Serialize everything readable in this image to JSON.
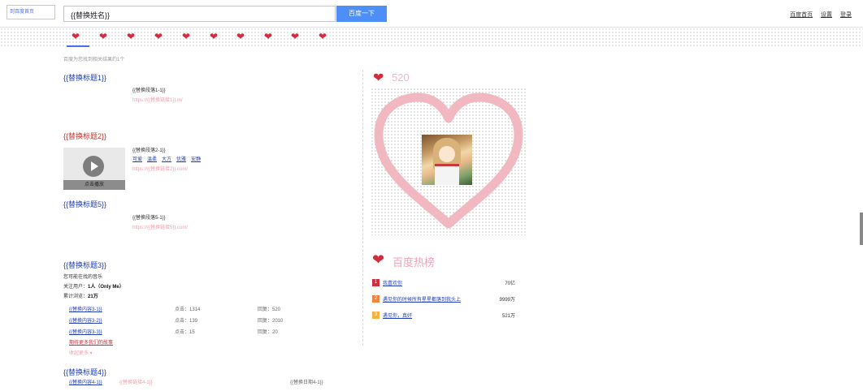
{
  "header": {
    "logo_alt": "到百度首页",
    "search_value": "{{替换姓名}}",
    "search_button": "百度一下",
    "links": [
      "百度首页",
      "设置",
      "登录"
    ]
  },
  "heart_strip": {
    "count": 10
  },
  "result_count": "百度为您找到相关结果约1个",
  "results": {
    "r1": {
      "title": "{{替换标题1}}",
      "desc": "{{替换段落1-1}}",
      "url": "https://{{替换链接1}}.m/"
    },
    "r2": {
      "title": "{{替换标题2}}",
      "desc": "{{替换段落2-1}}",
      "sublinks": [
        "可爱",
        "温柔",
        "大方",
        "优雅",
        "安静"
      ],
      "url": "https://{{替换链接2}}.com/",
      "video_label": "点击播放"
    },
    "r3": {
      "title": "{{替换标题5}}",
      "desc": "{{替换段落5-1}}",
      "url": "https://{{替换链接5}}.com/"
    },
    "r4": {
      "title": "{{替换标题3}}",
      "subtitle": "您可能在找的音乐",
      "focus_label": "关注用户：",
      "focus_value": "1人（Only Me）",
      "total_label": "累计浏览：",
      "total_value": "21万",
      "rows": [
        {
          "link": "{{替换内容3-1}}",
          "clicks": "点击：1314",
          "replies": "回复：520"
        },
        {
          "link": "{{替换内容3-2}}",
          "clicks": "点击：139",
          "replies": "回复：2010"
        },
        {
          "link": "{{替换内容3-3}}",
          "clicks": "点击：15",
          "replies": "回复：20"
        }
      ],
      "more": "期待更多我们的故事",
      "fold": "收起更多 ▾"
    },
    "r5": {
      "title": "{{替换标题4}}",
      "row": "{{替换内容4-1}}",
      "pink": "{{替换链接4-1}}",
      "date": "{{替换日期4-1}}"
    }
  },
  "right": {
    "count": "520",
    "hot_title": "百度热榜",
    "hot_items": [
      {
        "rank": "1",
        "text": "我喜欢你",
        "num": "70亿",
        "color": "#d12d3f"
      },
      {
        "rank": "2",
        "text": "遇见你的时候所有星星都落到我头上",
        "num": "9999万",
        "color": "#f0853b"
      },
      {
        "rank": "3",
        "text": "遇见你，真好",
        "num": "521万",
        "color": "#f4b23f"
      }
    ]
  },
  "colors": {
    "link": "#2440b3",
    "heart": "#d12d3f",
    "pink": "#f4b6c2",
    "button": "#4e8ef7"
  }
}
